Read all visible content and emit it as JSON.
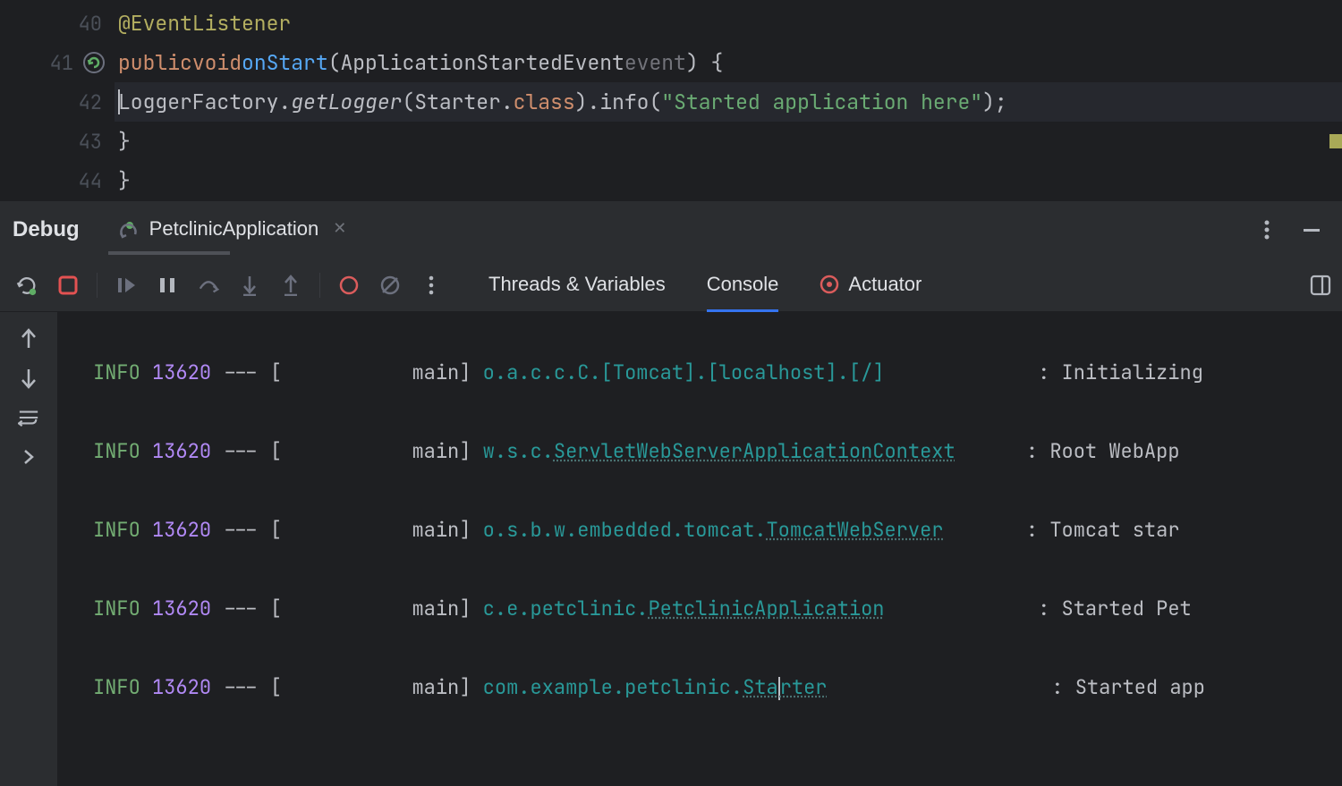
{
  "editor": {
    "lines": [
      {
        "num": "40"
      },
      {
        "num": "41"
      },
      {
        "num": "42"
      },
      {
        "num": "43"
      },
      {
        "num": "44"
      }
    ],
    "code": {
      "l40_annot": "@EventListener",
      "l41_kw1": "public",
      "l41_kw2": "void",
      "l41_method": "onStart",
      "l41_type": "ApplicationStartedEvent",
      "l41_param": "event",
      "l42_factory": "LoggerFactory",
      "l42_get": "getLogger",
      "l42_starter": "Starter",
      "l42_class": "class",
      "l42_info": "info",
      "l42_str": "\"Started application here\"",
      "l43_brace": "}",
      "l44_brace": "}"
    }
  },
  "debug": {
    "label": "Debug",
    "run_tab": "PetclinicApplication",
    "subtabs": {
      "threads": "Threads & Variables",
      "console": "Console",
      "actuator": "Actuator"
    }
  },
  "console": {
    "rows": [
      {
        "level": "INFO",
        "pid": "13620",
        "sep": "--- [",
        "thread": "main]",
        "class_plain": "o.a.c.c.C.[Tomcat].[localhost].[/]",
        "class_link": "",
        "colon": " : ",
        "msg": "Initializing"
      },
      {
        "level": "INFO",
        "pid": "13620",
        "sep": "--- [",
        "thread": "main]",
        "class_plain": "w.s.c.",
        "class_link": "ServletWebServerApplicationContext",
        "colon": " : ",
        "msg": "Root WebApp"
      },
      {
        "level": "INFO",
        "pid": "13620",
        "sep": "--- [",
        "thread": "main]",
        "class_plain": "o.s.b.w.embedded.tomcat.",
        "class_link": "TomcatWebServer",
        "colon": " : ",
        "msg": "Tomcat star"
      },
      {
        "level": "INFO",
        "pid": "13620",
        "sep": "--- [",
        "thread": "main]",
        "class_plain": "c.e.petclinic.",
        "class_link": "PetclinicApplication",
        "colon": " : ",
        "msg": "Started Pet"
      },
      {
        "level": "INFO",
        "pid": "13620",
        "sep": "--- [",
        "thread": "main]",
        "class_plain": "com.example.petclinic.",
        "class_link": "Starter",
        "colon": " : ",
        "msg": "Started app"
      }
    ]
  }
}
